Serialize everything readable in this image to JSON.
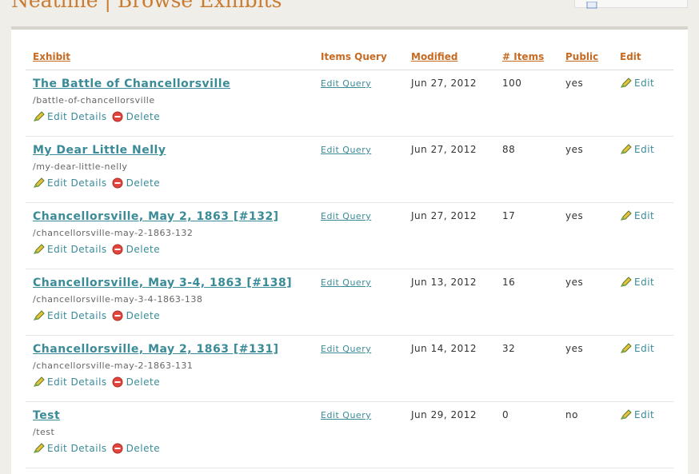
{
  "page": {
    "title": "Neatline | Browse Exhibits"
  },
  "table": {
    "headers": {
      "exhibit": "Exhibit",
      "query": "Items Query",
      "modified": "Modified",
      "items": "# Items",
      "public": "Public",
      "edit": "Edit"
    },
    "row_actions": {
      "edit_details": "Edit Details",
      "delete": "Delete",
      "edit_query": "Edit Query",
      "edit": "Edit"
    },
    "rows": [
      {
        "title": "The Battle of Chancellorsville",
        "slug": "/battle-of-chancellorsville",
        "modified": "Jun 27, 2012",
        "items": "100",
        "public": "yes"
      },
      {
        "title": "My Dear Little Nelly",
        "slug": "/my-dear-little-nelly",
        "modified": "Jun 27, 2012",
        "items": "88",
        "public": "yes"
      },
      {
        "title": "Chancellorsville, May 2, 1863 [#132]",
        "slug": "/chancellorsville-may-2-1863-132",
        "modified": "Jun 27, 2012",
        "items": "17",
        "public": "yes"
      },
      {
        "title": "Chancellorsville, May 3-4, 1863 [#138]",
        "slug": "/chancellorsville-may-3-4-1863-138",
        "modified": "Jun 13, 2012",
        "items": "16",
        "public": "yes"
      },
      {
        "title": "Chancellorsville, May 2, 1863 [#131]",
        "slug": "/chancellorsville-may-2-1863-131",
        "modified": "Jun 14, 2012",
        "items": "32",
        "public": "yes"
      },
      {
        "title": "Test",
        "slug": "/test",
        "modified": "Jun 29, 2012",
        "items": "0",
        "public": "no"
      }
    ]
  },
  "colors": {
    "accent": "#c76a22",
    "link": "#3a8b98",
    "delete": "#d9342b"
  },
  "icons": {
    "edit": "pencil-icon",
    "delete": "delete-icon",
    "search": "search-icon"
  }
}
